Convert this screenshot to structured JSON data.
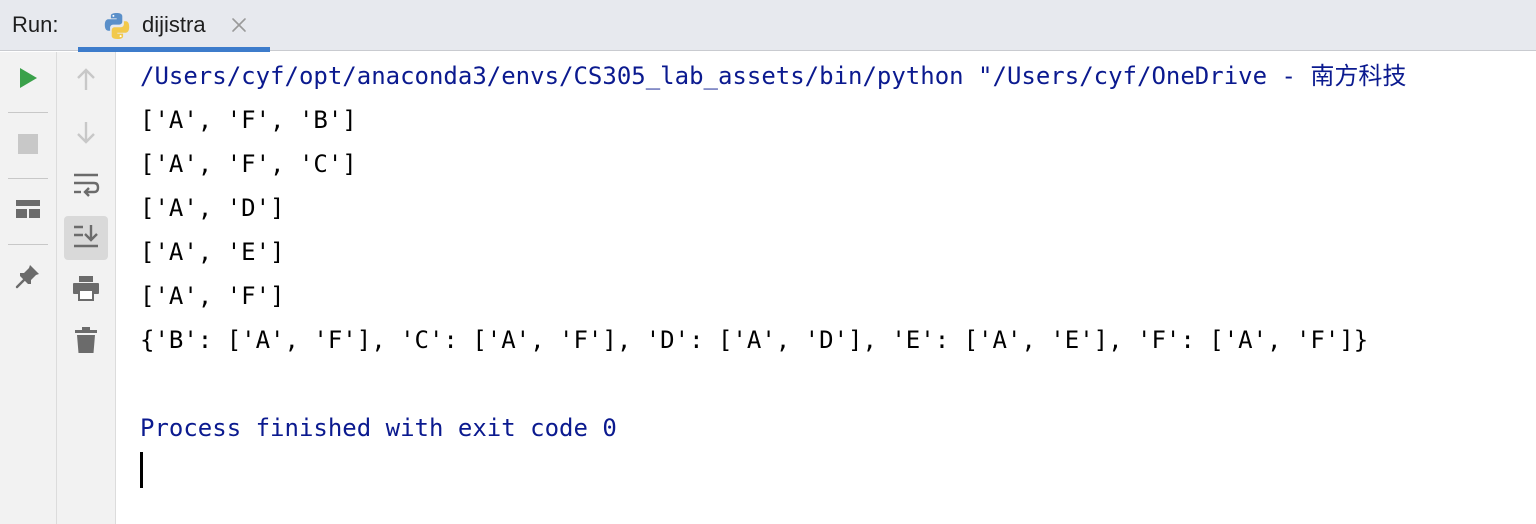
{
  "header": {
    "run_label": "Run:",
    "tab": {
      "label": "dijistra",
      "icon": "python-icon",
      "close_icon": "close-icon"
    },
    "accent_color": "#3d7ccb"
  },
  "toolbar_left": [
    {
      "name": "rerun-button",
      "icon": "play-icon",
      "color": "#3aa14a"
    },
    {
      "name": "stop-button",
      "icon": "stop-icon",
      "color": "#c8c8c8"
    },
    {
      "name": "restore-layout-button",
      "icon": "layout-icon",
      "color": "#6b6b6b"
    },
    {
      "name": "pin-tab-button",
      "icon": "pin-icon",
      "color": "#6b6b6b"
    }
  ],
  "toolbar_mid": [
    {
      "name": "up-stack-button",
      "icon": "arrow-up-icon",
      "color": "#c8c8c8"
    },
    {
      "name": "down-stack-button",
      "icon": "arrow-down-icon",
      "color": "#c8c8c8"
    },
    {
      "name": "soft-wrap-button",
      "icon": "soft-wrap-icon",
      "color": "#6b6b6b"
    },
    {
      "name": "scroll-to-end-button",
      "icon": "scroll-to-end-icon",
      "color": "#6b6b6b",
      "active": true
    },
    {
      "name": "print-button",
      "icon": "print-icon",
      "color": "#6b6b6b"
    },
    {
      "name": "clear-all-button",
      "icon": "trash-icon",
      "color": "#6b6b6b"
    }
  ],
  "console": {
    "command_line": "/Users/cyf/opt/anaconda3/envs/CS305_lab_assets/bin/python \"/Users/cyf/OneDrive - 南方科技",
    "output_lines": [
      "['A', 'F', 'B']",
      "['A', 'F', 'C']",
      "['A', 'D']",
      "['A', 'E']",
      "['A', 'F']",
      "{'B': ['A', 'F'], 'C': ['A', 'F'], 'D': ['A', 'D'], 'E': ['A', 'E'], 'F': ['A', 'F']}"
    ],
    "exit_message": "Process finished with exit code 0",
    "text_color": "#000000",
    "system_text_color": "#0b1a8f"
  }
}
